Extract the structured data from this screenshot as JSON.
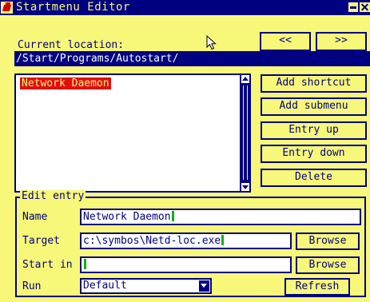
{
  "window": {
    "title": "Startmenu Editor",
    "colors": {
      "background": "#f7f77a",
      "foreground": "#000080",
      "selection": "#e01010",
      "caret": "#10b010"
    }
  },
  "location": {
    "label": "Current location:",
    "path": "/Start/Programs/Autostart/",
    "back_label": "<<",
    "forward_label": ">>"
  },
  "entries": {
    "items": [
      {
        "label": "Network Daemon",
        "selected": true
      }
    ]
  },
  "actions": {
    "add_shortcut": "Add shortcut",
    "add_submenu": "Add submenu",
    "entry_up": "Entry up",
    "entry_down": "Entry down",
    "delete": "Delete"
  },
  "edit_entry": {
    "title": "Edit entry",
    "name_label": "Name",
    "name_value": "Network Daemon",
    "target_label": "Target",
    "target_value": "c:\\symbos\\Netd-loc.exe",
    "startin_label": "Start in",
    "startin_value": "",
    "run_label": "Run",
    "run_value": "Default",
    "browse_label": "Browse",
    "refresh_label": "Refresh"
  }
}
